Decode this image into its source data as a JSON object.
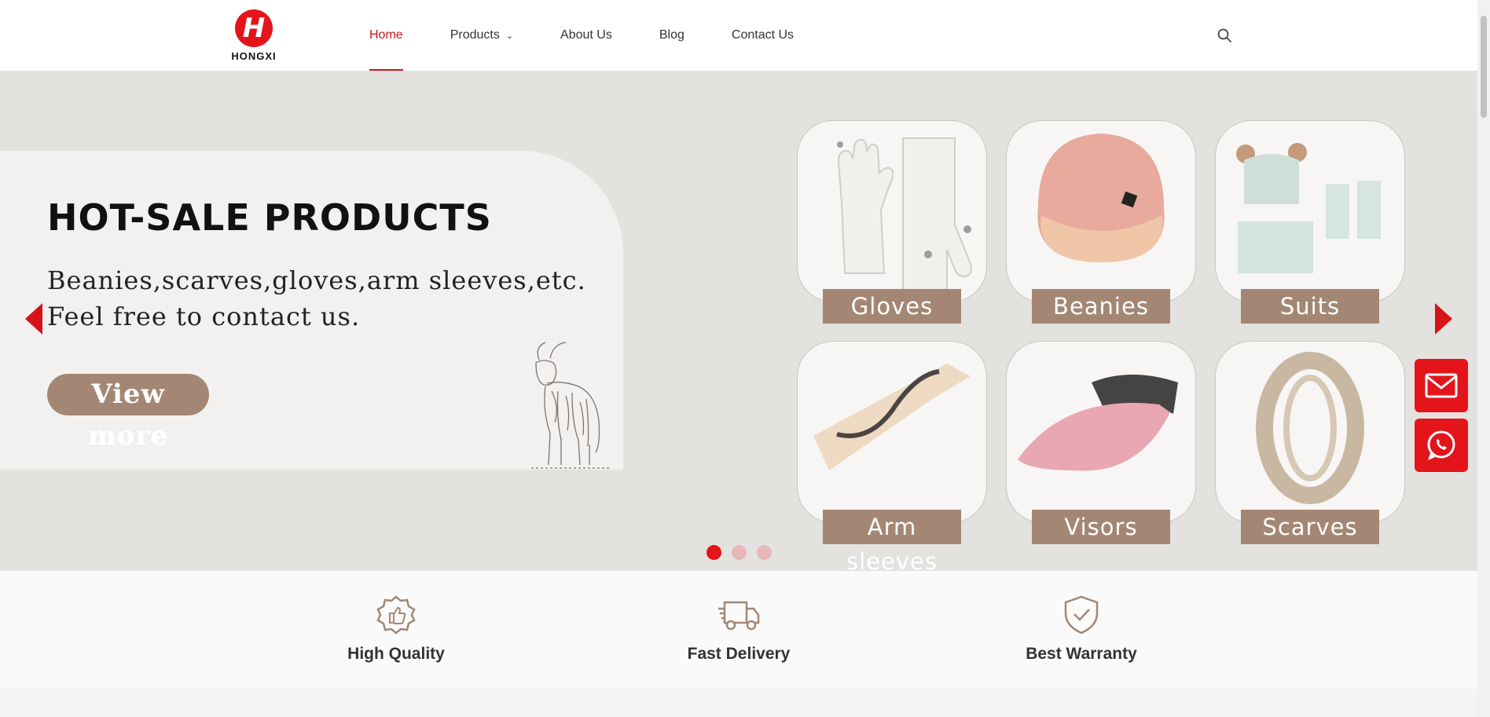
{
  "header": {
    "logo_text": "HONGXI",
    "nav": [
      {
        "label": "Home",
        "active": true
      },
      {
        "label": "Products",
        "has_dropdown": true
      },
      {
        "label": "About Us"
      },
      {
        "label": "Blog"
      },
      {
        "label": "Contact Us"
      }
    ],
    "search_icon": "search-icon"
  },
  "hero": {
    "title": "HOT-SALE PRODUCTS",
    "subtitle_line1": "Beanies,scarves,gloves,arm sleeves,etc.",
    "subtitle_line2": "Feel free to contact us.",
    "button_label": "View more",
    "cards": [
      {
        "label": "Gloves"
      },
      {
        "label": "Beanies"
      },
      {
        "label": "Suits"
      },
      {
        "label": "Arm sleeves"
      },
      {
        "label": "Visors"
      },
      {
        "label": "Scarves"
      }
    ],
    "slide_count": 3,
    "active_slide": 1
  },
  "floating": {
    "email_icon": "mail-icon",
    "whatsapp_icon": "whatsapp-icon"
  },
  "features": [
    {
      "label": "High Quality",
      "icon": "thumbs-up-badge-icon"
    },
    {
      "label": "Fast Delivery",
      "icon": "delivery-truck-icon"
    },
    {
      "label": "Best Warranty",
      "icon": "shield-check-icon"
    }
  ],
  "colors": {
    "brand_red": "#e4141b",
    "accent_brown": "#a38774",
    "hero_bg": "#e4e2df"
  }
}
